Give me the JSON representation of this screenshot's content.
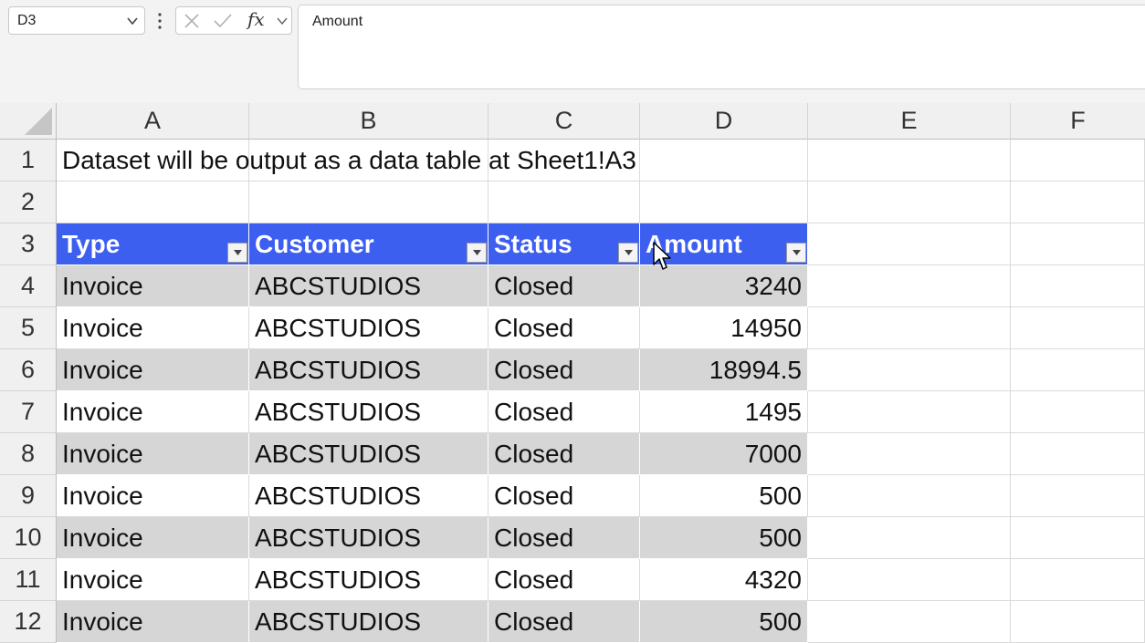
{
  "name_box": {
    "value": "D3"
  },
  "formula_bar": {
    "value": "Amount",
    "fx_label": "fx"
  },
  "columns": [
    "A",
    "B",
    "C",
    "D",
    "E",
    "F"
  ],
  "rows": [
    "1",
    "2",
    "3",
    "4",
    "5",
    "6",
    "7",
    "8",
    "9",
    "10",
    "11",
    "12"
  ],
  "sheet": {
    "title": "Dataset will be output as a data table at Sheet1!A3",
    "table": {
      "headers": [
        "Type",
        "Customer",
        "Status",
        "Amount"
      ],
      "rows": [
        [
          "Invoice",
          "ABCSTUDIOS",
          "Closed",
          "3240"
        ],
        [
          "Invoice",
          "ABCSTUDIOS",
          "Closed",
          "14950"
        ],
        [
          "Invoice",
          "ABCSTUDIOS",
          "Closed",
          "18994.5"
        ],
        [
          "Invoice",
          "ABCSTUDIOS",
          "Closed",
          "1495"
        ],
        [
          "Invoice",
          "ABCSTUDIOS",
          "Closed",
          "7000"
        ],
        [
          "Invoice",
          "ABCSTUDIOS",
          "Closed",
          "500"
        ],
        [
          "Invoice",
          "ABCSTUDIOS",
          "Closed",
          "500"
        ],
        [
          "Invoice",
          "ABCSTUDIOS",
          "Closed",
          "4320"
        ],
        [
          "Invoice",
          "ABCSTUDIOS",
          "Closed",
          "500"
        ]
      ]
    }
  },
  "colors": {
    "table_header": "#3d5ff0",
    "band": "#d6d6d6"
  }
}
